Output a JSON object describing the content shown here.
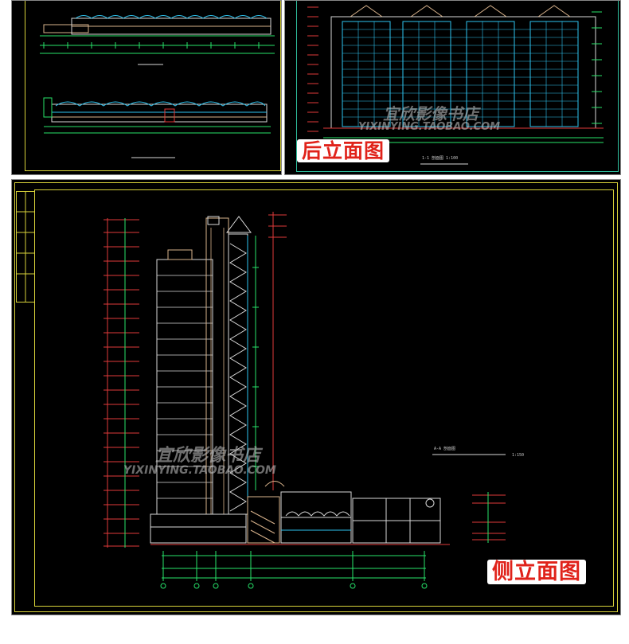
{
  "labels": {
    "rear_elevation": "后立面图",
    "side_elevation": "侧立面图"
  },
  "watermark": {
    "brand_top": "宜欣影像书店",
    "brand_bottom": "宜欣影像书店",
    "url": "YIXINYING.TAOBAO.COM"
  },
  "drawing_titles": {
    "rear_caption": "1-1 剖面图 1:100",
    "section_caption": "A-A 剖面图",
    "section_scale": "1:150"
  },
  "colors": {
    "label_text": "#e0221a",
    "frame_yellow": "#d8d23a",
    "frame_green": "#2fbf9f",
    "cad_green": "#27e36a",
    "cad_cyan": "#2ec4f0",
    "cad_red": "#e03a3a",
    "cad_white": "#d8d8d8",
    "cad_tan": "#d9b38c"
  }
}
